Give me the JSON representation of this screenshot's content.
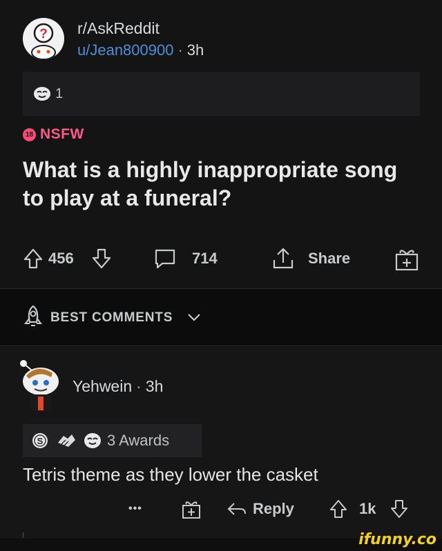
{
  "post": {
    "subreddit": "r/AskReddit",
    "author": "u/Jean800900",
    "separator": "·",
    "time": "3h",
    "award_count": "1",
    "nsfw_badge": "18",
    "nsfw_label": "NSFW",
    "title": "What is a highly inappropriate song to play at a funeral?",
    "upvotes": "456",
    "comments": "714",
    "share_label": "Share"
  },
  "sort": {
    "label": "BEST COMMENTS"
  },
  "comment": {
    "author": "Yehwein",
    "separator": "·",
    "time": "3h",
    "awards_label": "3 Awards",
    "body": "Tetris theme as they lower the casket",
    "more": "•••",
    "reply_label": "Reply",
    "score": "1k"
  },
  "watermark": "ifunny.co",
  "colors": {
    "background": "#141414",
    "link": "#4f8fd9",
    "nsfw": "#ff4a78",
    "text": "#d7dadc"
  }
}
